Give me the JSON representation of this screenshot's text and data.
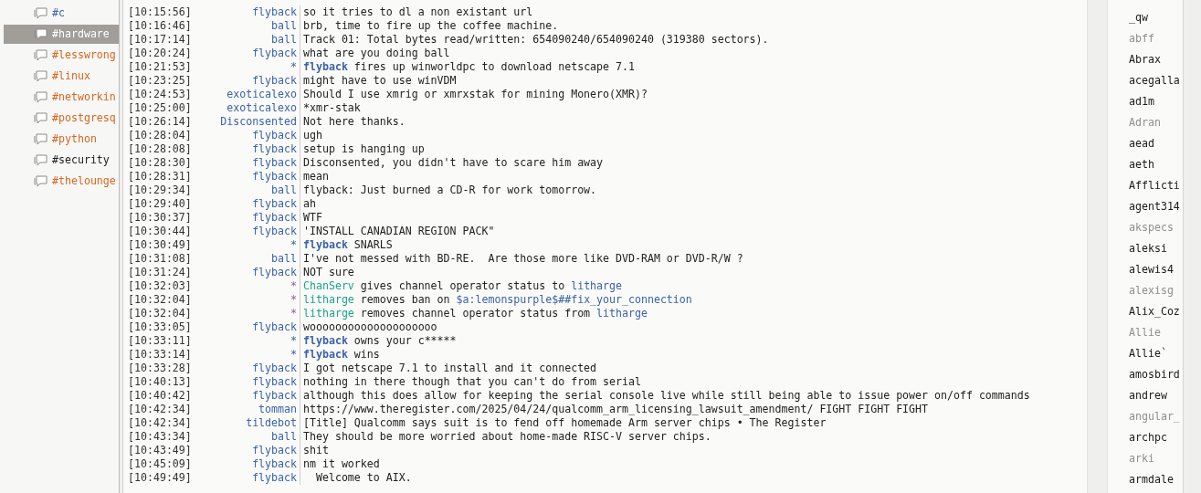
{
  "channels": [
    {
      "name": "#c",
      "color": "#3b63a8",
      "selected": false
    },
    {
      "name": "#hardware",
      "selected": true
    },
    {
      "name": "#lesswrong",
      "color": "#d9661f",
      "selected": false
    },
    {
      "name": "#linux",
      "color": "#d9661f",
      "selected": false
    },
    {
      "name": "#networkin",
      "color": "#d9661f",
      "selected": false
    },
    {
      "name": "#postgresq",
      "color": "#d9661f",
      "selected": false
    },
    {
      "name": "#python",
      "color": "#d9661f",
      "selected": false
    },
    {
      "name": "#security",
      "color": "#222222",
      "selected": false
    },
    {
      "name": "#thelounge",
      "color": "#d9661f",
      "selected": false
    }
  ],
  "messages": [
    {
      "time": "[10:15:56]",
      "nick": "flyback",
      "kind": "message",
      "parts": [
        {
          "text": "so it tries to dl a non existant url"
        }
      ]
    },
    {
      "time": "[10:16:46]",
      "nick": "ball",
      "kind": "message",
      "parts": [
        {
          "text": "brb, time to fire up the coffee machine."
        }
      ]
    },
    {
      "time": "[10:17:14]",
      "nick": "ball",
      "kind": "message",
      "parts": [
        {
          "text": "Track 01: Total bytes read/written: 654090240/654090240 (319380 sectors)."
        }
      ]
    },
    {
      "time": "[10:20:24]",
      "nick": "flyback",
      "kind": "message",
      "parts": [
        {
          "text": "what are you doing ball"
        }
      ]
    },
    {
      "time": "[10:21:53]",
      "nick": "*",
      "kind": "action",
      "parts": [
        {
          "text": "flyback",
          "kind": "actor"
        },
        {
          "text": " fires up winworldpc to download netscape 7.1"
        }
      ]
    },
    {
      "time": "[10:23:25]",
      "nick": "flyback",
      "kind": "message",
      "parts": [
        {
          "text": "might have to use winVDM"
        }
      ]
    },
    {
      "time": "[10:24:53]",
      "nick": "exoticalexo",
      "kind": "message",
      "parts": [
        {
          "text": "Should I use xmrig or xmrxstak for mining Monero(XMR)?"
        }
      ]
    },
    {
      "time": "[10:25:00]",
      "nick": "exoticalexo",
      "kind": "message",
      "parts": [
        {
          "text": "*xmr-stak"
        }
      ]
    },
    {
      "time": "[10:26:14]",
      "nick": "Disconsented",
      "kind": "message",
      "parts": [
        {
          "text": "Not here thanks."
        }
      ]
    },
    {
      "time": "[10:28:04]",
      "nick": "flyback",
      "kind": "message",
      "parts": [
        {
          "text": "ugh"
        }
      ]
    },
    {
      "time": "[10:28:08]",
      "nick": "flyback",
      "kind": "message",
      "parts": [
        {
          "text": "setup is hanging up"
        }
      ]
    },
    {
      "time": "[10:28:30]",
      "nick": "flyback",
      "kind": "message",
      "parts": [
        {
          "text": "Disconsented, you didn't have to scare him away"
        }
      ]
    },
    {
      "time": "[10:28:31]",
      "nick": "flyback",
      "kind": "message",
      "parts": [
        {
          "text": "mean"
        }
      ]
    },
    {
      "time": "[10:29:34]",
      "nick": "ball",
      "kind": "message",
      "parts": [
        {
          "text": "flyback: Just burned a CD-R for work tomorrow."
        }
      ]
    },
    {
      "time": "[10:29:40]",
      "nick": "flyback",
      "kind": "message",
      "parts": [
        {
          "text": "ah"
        }
      ]
    },
    {
      "time": "[10:30:37]",
      "nick": "flyback",
      "kind": "message",
      "parts": [
        {
          "text": "WTF"
        }
      ]
    },
    {
      "time": "[10:30:44]",
      "nick": "flyback",
      "kind": "message",
      "parts": [
        {
          "text": "'INSTALL CANADIAN REGION PACK\""
        }
      ]
    },
    {
      "time": "[10:30:49]",
      "nick": "*",
      "kind": "action",
      "parts": [
        {
          "text": "flyback",
          "kind": "actor"
        },
        {
          "text": " SNARLS"
        }
      ]
    },
    {
      "time": "[10:31:08]",
      "nick": "ball",
      "kind": "message",
      "parts": [
        {
          "text": "I've not messed with BD-RE.  Are those more like DVD-RAM or DVD-R/W ?"
        }
      ]
    },
    {
      "time": "[10:31:24]",
      "nick": "flyback",
      "kind": "message",
      "parts": [
        {
          "text": "NOT sure"
        }
      ]
    },
    {
      "time": "[10:32:03]",
      "nick": "*",
      "kind": "mode",
      "parts": [
        {
          "text": "ChanServ",
          "kind": "source"
        },
        {
          "text": " gives channel operator status to "
        },
        {
          "text": "litharge",
          "kind": "target"
        }
      ]
    },
    {
      "time": "[10:32:04]",
      "nick": "*",
      "kind": "mode",
      "parts": [
        {
          "text": "litharge",
          "kind": "source"
        },
        {
          "text": " removes ban on "
        },
        {
          "text": "$a:lemonspurple$##fix_your_connection",
          "kind": "target"
        }
      ]
    },
    {
      "time": "[10:32:04]",
      "nick": "*",
      "kind": "mode",
      "parts": [
        {
          "text": "litharge",
          "kind": "source"
        },
        {
          "text": " removes channel operator status from "
        },
        {
          "text": "litharge",
          "kind": "target"
        }
      ]
    },
    {
      "time": "[10:33:05]",
      "nick": "flyback",
      "kind": "message",
      "parts": [
        {
          "text": "woooooooooooooooooooo"
        }
      ]
    },
    {
      "time": "[10:33:11]",
      "nick": "*",
      "kind": "action",
      "parts": [
        {
          "text": "flyback",
          "kind": "actor"
        },
        {
          "text": " owns your c*****"
        }
      ]
    },
    {
      "time": "[10:33:14]",
      "nick": "*",
      "kind": "action",
      "parts": [
        {
          "text": "flyback",
          "kind": "actor"
        },
        {
          "text": " wins"
        }
      ]
    },
    {
      "time": "[10:33:28]",
      "nick": "flyback",
      "kind": "message",
      "parts": [
        {
          "text": "I got netscape 7.1 to install and it connected"
        }
      ]
    },
    {
      "time": "[10:40:13]",
      "nick": "flyback",
      "kind": "message",
      "parts": [
        {
          "text": "nothing in there though that you can't do from serial"
        }
      ]
    },
    {
      "time": "[10:40:42]",
      "nick": "flyback",
      "kind": "message",
      "parts": [
        {
          "text": "although this does allow for keeping the serial console live while still being able to issue power on/off commands"
        }
      ]
    },
    {
      "time": "[10:42:34]",
      "nick": "tomman",
      "kind": "message",
      "parts": [
        {
          "text": "https://www.theregister.com/2025/04/24/qualcomm_arm_licensing_lawsuit_amendment/ FIGHT FIGHT FIGHT"
        }
      ]
    },
    {
      "time": "[10:42:34]",
      "nick": "tildebot",
      "kind": "message",
      "parts": [
        {
          "text": "[Title] Qualcomm says suit is to fend off homemade Arm server chips • The Register"
        }
      ]
    },
    {
      "time": "[10:43:34]",
      "nick": "ball",
      "kind": "message",
      "parts": [
        {
          "text": "They should be more worried about home-made RISC-V server chips."
        }
      ]
    },
    {
      "time": "[10:43:49]",
      "nick": "flyback",
      "kind": "message",
      "parts": [
        {
          "text": "shit"
        }
      ]
    },
    {
      "time": "[10:45:09]",
      "nick": "flyback",
      "kind": "message",
      "parts": [
        {
          "text": "nm it worked"
        }
      ]
    },
    {
      "time": "[10:49:49]",
      "nick": "flyback",
      "kind": "message",
      "parts": [
        {
          "text": "  Welcome to AIX."
        }
      ]
    }
  ],
  "users": [
    {
      "nick": "_qw",
      "away": false
    },
    {
      "nick": "abff",
      "away": true
    },
    {
      "nick": "Abrax",
      "away": false
    },
    {
      "nick": "acegalla",
      "away": false
    },
    {
      "nick": "ad1m",
      "away": false
    },
    {
      "nick": "Adran",
      "away": true
    },
    {
      "nick": "aead",
      "away": false
    },
    {
      "nick": "aeth",
      "away": false
    },
    {
      "nick": "Afflicti",
      "away": false
    },
    {
      "nick": "agent314",
      "away": false
    },
    {
      "nick": "akspecs",
      "away": true
    },
    {
      "nick": "aleksi",
      "away": false
    },
    {
      "nick": "alewis4",
      "away": false
    },
    {
      "nick": "alexisg",
      "away": true
    },
    {
      "nick": "Alix_Coz",
      "away": false
    },
    {
      "nick": "Allie",
      "away": true
    },
    {
      "nick": "Allie`",
      "away": false
    },
    {
      "nick": "amosbird",
      "away": false
    },
    {
      "nick": "andrew",
      "away": false
    },
    {
      "nick": "angular_",
      "away": true
    },
    {
      "nick": "archpc",
      "away": false
    },
    {
      "nick": "arki",
      "away": true
    },
    {
      "nick": "armdale",
      "away": false
    }
  ]
}
